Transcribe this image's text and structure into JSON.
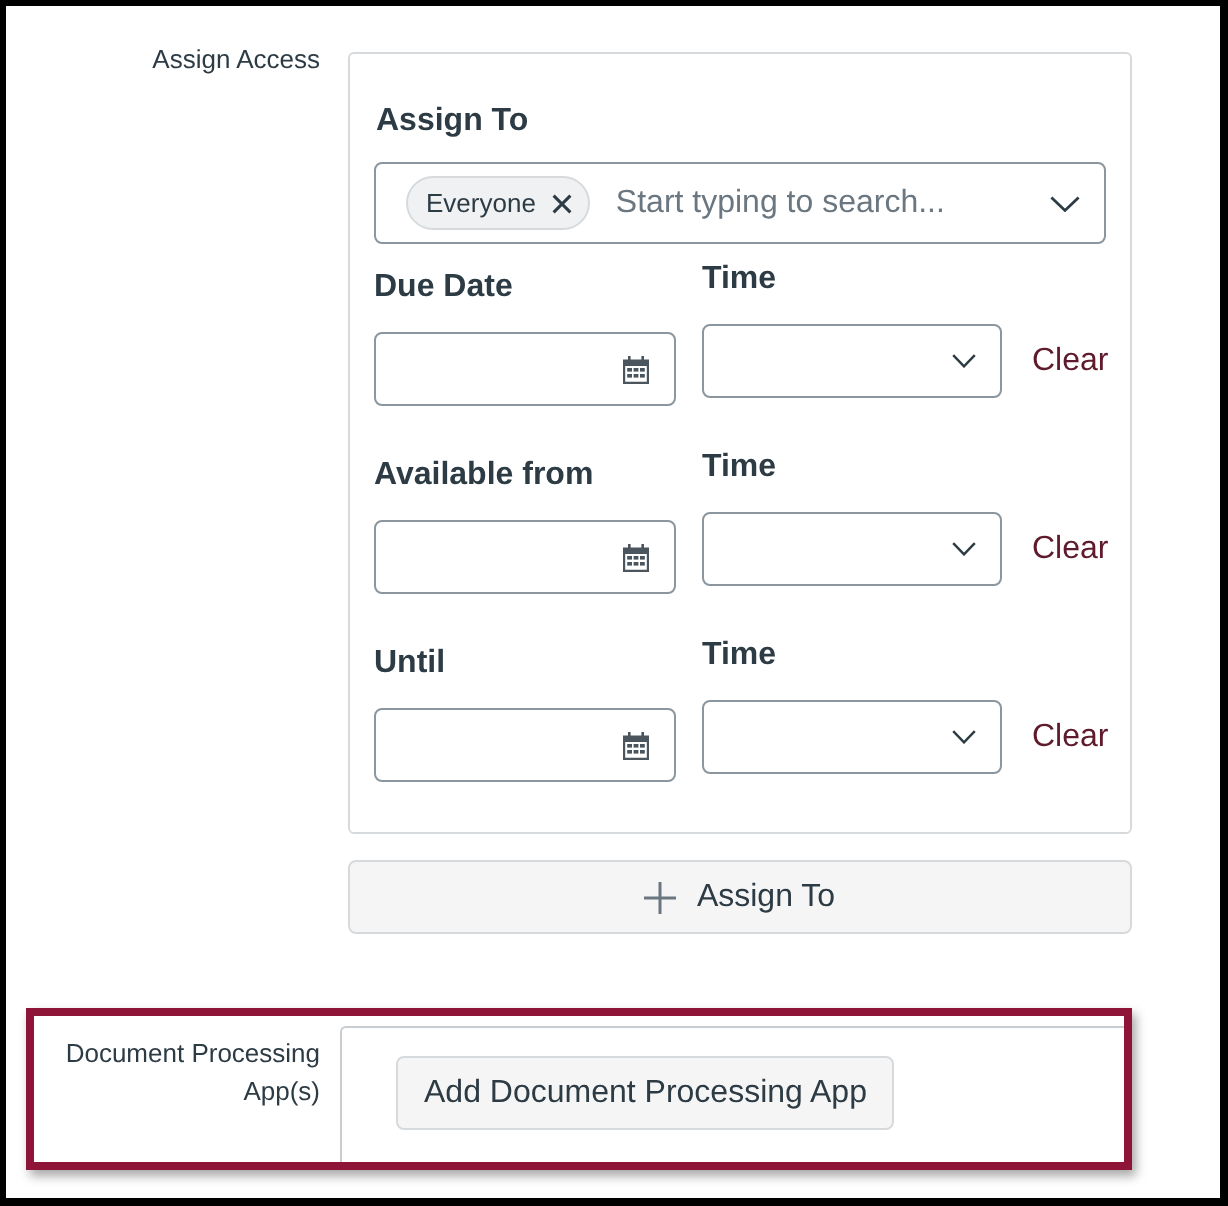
{
  "assign_access": {
    "label": "Assign Access",
    "card": {
      "heading": "Assign To",
      "assignee_field": {
        "tags": [
          {
            "label": "Everyone"
          }
        ],
        "placeholder": "Start typing to search..."
      },
      "date_rows": [
        {
          "date_label": "Due Date",
          "time_label": "Time",
          "clear": "Clear"
        },
        {
          "date_label": "Available from",
          "time_label": "Time",
          "clear": "Clear"
        },
        {
          "date_label": "Until",
          "time_label": "Time",
          "clear": "Clear"
        }
      ]
    },
    "add_button": "Assign To"
  },
  "document_processing": {
    "label": "Document Processing App(s)",
    "highlighted": true,
    "button": "Add Document Processing App"
  }
}
